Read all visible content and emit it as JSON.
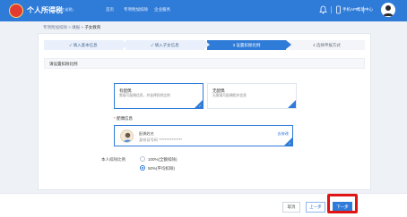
{
  "header": {
    "app_title": "个人所得税",
    "app_subtitle": "(浙江省税)",
    "nav": [
      "首页",
      "专项附加扣除",
      "企业服务"
    ],
    "app_download": "手机APP",
    "help": "帮助中心",
    "colors": {
      "bar": "#2f7bd8",
      "logo": "#e33b2f"
    }
  },
  "breadcrumb": [
    "专项附加扣除",
    "填报",
    "子女教育"
  ],
  "steps": [
    {
      "label": "✓ 填入基本信息",
      "state": "done"
    },
    {
      "label": "✓ 填入子女信息",
      "state": "done"
    },
    {
      "label": "3 设置扣除比例",
      "state": "active"
    },
    {
      "label": "4 选择申报方式",
      "state": "todo"
    }
  ],
  "section_title": "请设置扣除比例",
  "options": [
    {
      "title": "有配偶",
      "desc": "需填写配偶信息，并选择扣除比例",
      "selected": true
    },
    {
      "title": "无配偶",
      "desc": "无需填写配偶相关信息",
      "selected": false
    }
  ],
  "spouse": {
    "label": "配偶信息",
    "name": "配偶姓名",
    "id": "身份证号码 ****************",
    "edit": "去修改"
  },
  "ratio": {
    "label": "本人扣除比例",
    "options": [
      {
        "text": "100%(全额扣除)",
        "checked": false
      },
      {
        "text": "50%(平均扣除)",
        "checked": true
      }
    ]
  },
  "footer": {
    "cancel": "取消",
    "prev": "上一步",
    "next": "下一步",
    "highlight_color": "#e01414"
  }
}
